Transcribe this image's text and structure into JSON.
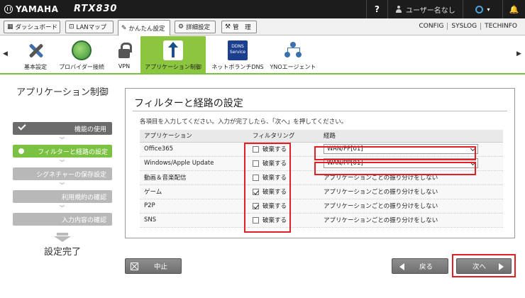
{
  "header": {
    "brand": "YAMAHA",
    "model": "RTX830",
    "help": "?",
    "user": "ユーザー名なし",
    "status_color": "#4aa3df",
    "bell": "🔔"
  },
  "tabs": [
    {
      "label": "ダッシュボード",
      "icon": "dashboard-icon"
    },
    {
      "label": "LANマップ",
      "icon": "lanmap-icon"
    },
    {
      "label": "かんたん設定",
      "icon": "easy-setup-icon",
      "active": true
    },
    {
      "label": "詳細設定",
      "icon": "gear-icon"
    },
    {
      "label": "管　理",
      "icon": "wrench-icon"
    }
  ],
  "top_links": [
    "CONFIG",
    "SYSLOG",
    "TECHINFO"
  ],
  "functions": [
    {
      "label": "基本設定",
      "icon": "tools-icon"
    },
    {
      "label": "プロバイダー接続",
      "icon": "globe-icon"
    },
    {
      "label": "VPN",
      "icon": "lock-icon"
    },
    {
      "label": "アプリケーション制御",
      "icon": "app-control-icon",
      "active": true
    },
    {
      "label": "ネットボランチDNS",
      "icon": "ddns-icon",
      "icon_text": "DDNS Service"
    },
    {
      "label": "YNOエージェント",
      "icon": "yno-icon"
    }
  ],
  "sidebar": {
    "title": "アプリケーション制御",
    "steps": [
      {
        "label": "機能の使用",
        "state": "done"
      },
      {
        "label": "フィルターと経路の設定",
        "state": "current"
      },
      {
        "label": "シグネチャーの保存設定",
        "state": "future"
      },
      {
        "label": "利用規約の確認",
        "state": "future"
      },
      {
        "label": "入力内容の確認",
        "state": "future"
      }
    ],
    "finish": "設定完了"
  },
  "main": {
    "title": "フィルターと経路の設定",
    "instruction": "各項目を入力してください。入力が完了したら、「次へ」を押してください。",
    "columns": [
      "アプリケーション",
      "フィルタリング",
      "経路"
    ],
    "rows": [
      {
        "app": "Office365",
        "filter_label": "破棄する",
        "filter_checked": false,
        "route": "WAN/PP[01]",
        "route_is_select": true
      },
      {
        "app": "Windows/Apple Update",
        "filter_label": "破棄する",
        "filter_checked": false,
        "route": "WAN/PP[01]",
        "route_is_select": true
      },
      {
        "app": "動画＆音楽配信",
        "filter_label": "破棄する",
        "filter_checked": false,
        "route": "アプリケーションごとの振り分けをしない",
        "route_is_select": false
      },
      {
        "app": "ゲーム",
        "filter_label": "破棄する",
        "filter_checked": true,
        "route": "アプリケーションごとの振り分けをしない",
        "route_is_select": false
      },
      {
        "app": "P2P",
        "filter_label": "破棄する",
        "filter_checked": true,
        "route": "アプリケーションごとの振り分けをしない",
        "route_is_select": false
      },
      {
        "app": "SNS",
        "filter_label": "破棄する",
        "filter_checked": false,
        "route": "アプリケーションごとの振り分けをしない",
        "route_is_select": false
      }
    ]
  },
  "buttons": {
    "cancel": "中止",
    "back": "戻る",
    "next": "次へ"
  },
  "colors": {
    "accent_green": "#7cc242",
    "highlight_red": "#e31e24",
    "topbar": "#1c1c1c"
  }
}
